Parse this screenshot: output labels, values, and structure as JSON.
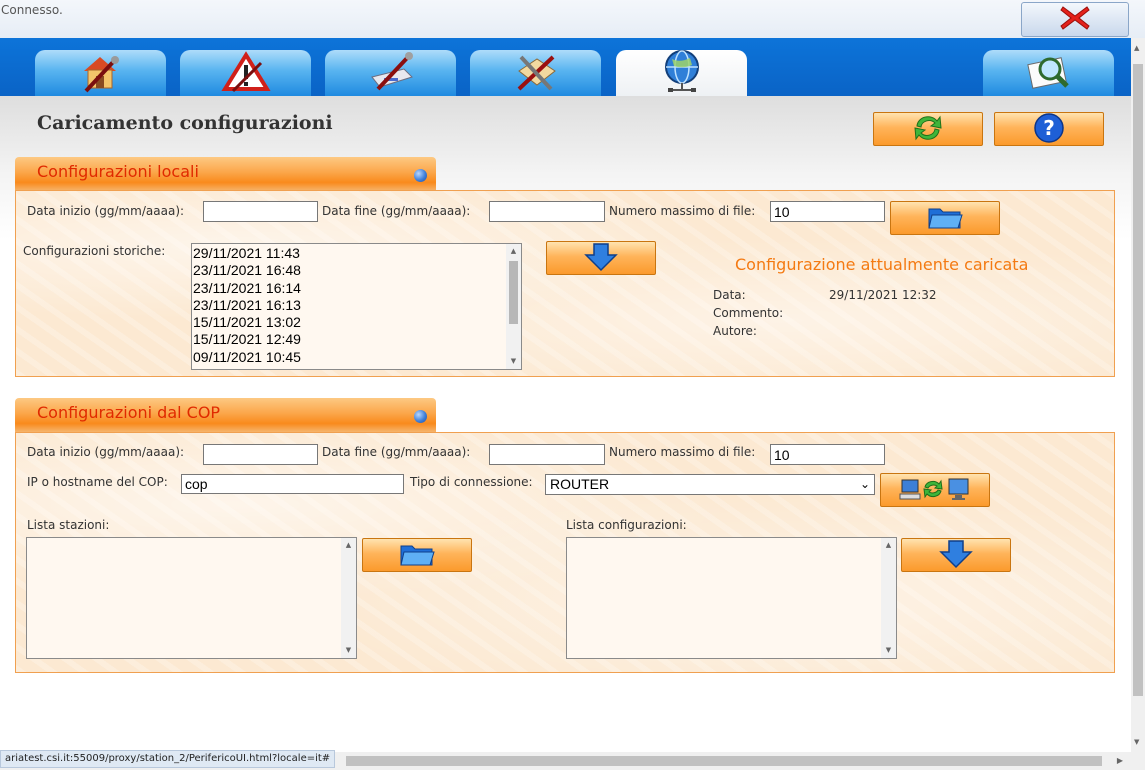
{
  "status": {
    "text": "Connesso."
  },
  "nav": {
    "tabs": [
      {
        "icon": "house-wrench-icon"
      },
      {
        "icon": "warning-wrench-icon"
      },
      {
        "icon": "disk-wrench-icon"
      },
      {
        "icon": "tools-map-icon"
      },
      {
        "icon": "network-globe-icon",
        "active": true
      },
      {
        "icon": "magnifier-icon"
      }
    ]
  },
  "page": {
    "title": "Caricamento configurazioni"
  },
  "local": {
    "header": "Configurazioni locali",
    "start_label": "Data inizio (gg/mm/aaaa):",
    "start_value": "",
    "end_label": "Data fine (gg/mm/aaaa):",
    "end_value": "",
    "max_label": "Numero massimo di file:",
    "max_value": "10",
    "history_label": "Configurazioni storiche:",
    "history": [
      "29/11/2021 11:43",
      "23/11/2021 16:48",
      "23/11/2021 16:14",
      "23/11/2021 16:13",
      "15/11/2021 13:02",
      "15/11/2021 12:49",
      "09/11/2021 10:45"
    ],
    "current": {
      "title": "Configurazione attualmente caricata",
      "date_label": "Data:",
      "date_value": "29/11/2021 12:32",
      "comment_label": "Commento:",
      "comment_value": "",
      "author_label": "Autore:",
      "author_value": ""
    }
  },
  "cop": {
    "header": "Configurazioni dal COP",
    "start_label": "Data inizio (gg/mm/aaaa):",
    "start_value": "",
    "end_label": "Data fine (gg/mm/aaaa):",
    "end_value": "",
    "max_label": "Numero massimo di file:",
    "max_value": "10",
    "ip_label": "IP o hostname del COP:",
    "ip_value": "cop",
    "conn_label": "Tipo di connessione:",
    "conn_value": "ROUTER",
    "stations_label": "Lista stazioni:",
    "configs_label": "Lista configurazioni:"
  },
  "footer": {
    "url": "ariatest.csi.it:55009/proxy/station_2/PerifericoUI.html?locale=it#"
  },
  "colors": {
    "nav_blue": "#0a68cc",
    "orange_button": "#fba33c",
    "section_title": "#e02a00",
    "current_title": "#f47a12",
    "panel_bg": "#fce9d2"
  }
}
